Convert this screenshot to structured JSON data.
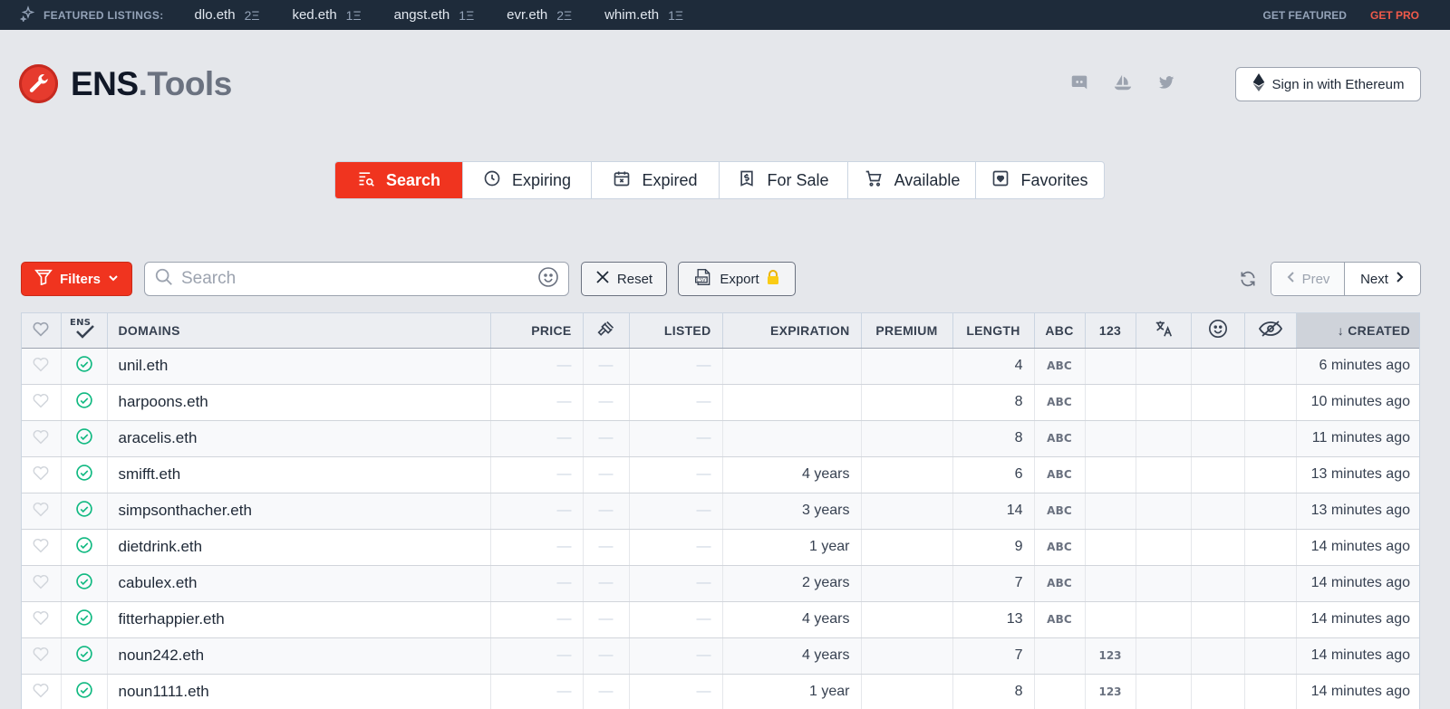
{
  "featured": {
    "label": "FEATURED LISTINGS:",
    "items": [
      {
        "name": "dlo.eth",
        "price": "2Ξ"
      },
      {
        "name": "ked.eth",
        "price": "1Ξ"
      },
      {
        "name": "angst.eth",
        "price": "1Ξ"
      },
      {
        "name": "evr.eth",
        "price": "2Ξ"
      },
      {
        "name": "whim.eth",
        "price": "1Ξ"
      }
    ],
    "get_featured": "GET FEATURED",
    "get_pro": "GET PRO"
  },
  "header": {
    "logo_ens": "ENS",
    "logo_tools": ".Tools",
    "signin_label": "Sign in with Ethereum"
  },
  "tabs": [
    {
      "label": "Search"
    },
    {
      "label": "Expiring"
    },
    {
      "label": "Expired"
    },
    {
      "label": "For Sale"
    },
    {
      "label": "Available"
    },
    {
      "label": "Favorites"
    }
  ],
  "toolbar": {
    "filters_label": "Filters",
    "search_placeholder": "Search",
    "reset_label": "Reset",
    "export_label": "Export",
    "prev_label": "Prev",
    "next_label": "Next"
  },
  "table": {
    "headers": {
      "domains": "DOMAINS",
      "price": "PRICE",
      "listed": "LISTED",
      "expiration": "EXPIRATION",
      "premium": "PREMIUM",
      "length": "LENGTH",
      "abc": "ABC",
      "num": "123",
      "created": "↓ CREATED"
    },
    "rows": [
      {
        "domain": "unil.eth",
        "expiration": "",
        "length": "4",
        "abc": "ABC",
        "num": "",
        "created": "6 minutes ago"
      },
      {
        "domain": "harpoons.eth",
        "expiration": "",
        "length": "8",
        "abc": "ABC",
        "num": "",
        "created": "10 minutes ago"
      },
      {
        "domain": "aracelis.eth",
        "expiration": "",
        "length": "8",
        "abc": "ABC",
        "num": "",
        "created": "11 minutes ago"
      },
      {
        "domain": "smifft.eth",
        "expiration": "4 years",
        "length": "6",
        "abc": "ABC",
        "num": "",
        "created": "13 minutes ago"
      },
      {
        "domain": "simpsonthacher.eth",
        "expiration": "3 years",
        "length": "14",
        "abc": "ABC",
        "num": "",
        "created": "13 minutes ago"
      },
      {
        "domain": "dietdrink.eth",
        "expiration": "1 year",
        "length": "9",
        "abc": "ABC",
        "num": "",
        "created": "14 minutes ago"
      },
      {
        "domain": "cabulex.eth",
        "expiration": "2 years",
        "length": "7",
        "abc": "ABC",
        "num": "",
        "created": "14 minutes ago"
      },
      {
        "domain": "fitterhappier.eth",
        "expiration": "4 years",
        "length": "13",
        "abc": "ABC",
        "num": "",
        "created": "14 minutes ago"
      },
      {
        "domain": "noun242.eth",
        "expiration": "4 years",
        "length": "7",
        "abc": "",
        "num": "123",
        "created": "14 minutes ago"
      },
      {
        "domain": "noun1111.eth",
        "expiration": "1 year",
        "length": "8",
        "abc": "",
        "num": "123",
        "created": "14 minutes ago"
      }
    ],
    "dash": "—"
  },
  "colors": {
    "brand_red": "#f0341f",
    "topbar_bg": "#1e2b3a",
    "check_green": "#10b981"
  }
}
